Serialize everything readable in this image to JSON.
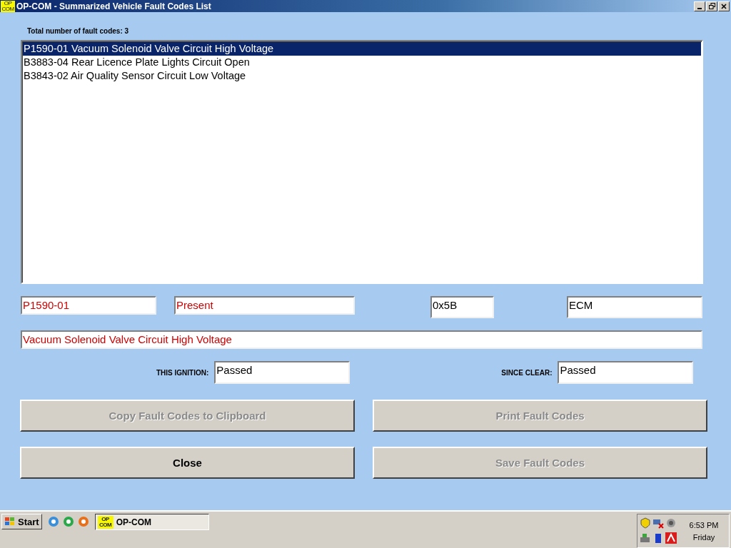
{
  "window": {
    "title": "OP-COM - Summarized Vehicle Fault Codes List",
    "app_icon": {
      "top": "OP",
      "bottom": "COM"
    }
  },
  "total_label": "Total number of fault codes: 3",
  "fault_codes": [
    {
      "text": "P1590-01 Vacuum Solenoid Valve Circuit High Voltage",
      "selected": true
    },
    {
      "text": "B3883-04 Rear Licence Plate Lights Circuit Open",
      "selected": false
    },
    {
      "text": "B3843-02 Air Quality Sensor Circuit Low Voltage",
      "selected": false
    }
  ],
  "details": {
    "code": "P1590-01",
    "status": "Present",
    "address": "0x5B",
    "module": "ECM",
    "description": "Vacuum Solenoid Valve Circuit High Voltage"
  },
  "this_ignition": {
    "label": "THIS IGNITION:",
    "value": "Passed"
  },
  "since_clear": {
    "label": "SINCE CLEAR:",
    "value": "Passed"
  },
  "buttons": [
    {
      "label": "Copy Fault Codes to Clipboard",
      "disabled": true
    },
    {
      "label": "Print Fault Codes",
      "disabled": true
    },
    {
      "label": "Close",
      "disabled": false
    },
    {
      "label": "Save Fault Codes",
      "disabled": true
    }
  ],
  "taskbar": {
    "start": "Start",
    "task": {
      "label": "OP-COM",
      "app_icon": {
        "top": "OP",
        "bottom": "COM"
      }
    },
    "time": "6:53 PM",
    "day": "Friday"
  }
}
